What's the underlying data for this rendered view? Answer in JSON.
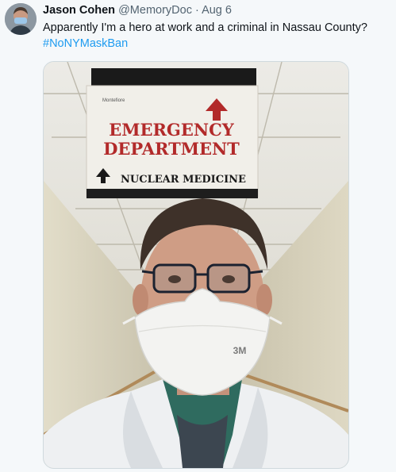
{
  "tweet": {
    "author_name": "Jason Cohen",
    "handle": "@MemoryDoc",
    "separator": "·",
    "date": "Aug 6",
    "text": "Apparently I'm a hero at work and a criminal in Nassau County?",
    "hashtag": "#NoNYMaskBan"
  },
  "photo": {
    "sign_small_text": "Montefiore",
    "sign_line_1": "EMERGENCY",
    "sign_line_2": "DEPARTMENT",
    "sign_line_3": "NUCLEAR MEDICINE",
    "mask_brand": "3M",
    "sign_text_color": "#b22a2a"
  },
  "icons": {
    "sign_arrow_up_red": "arrow-up-icon",
    "sign_arrow_up_black": "arrow-up-icon"
  }
}
